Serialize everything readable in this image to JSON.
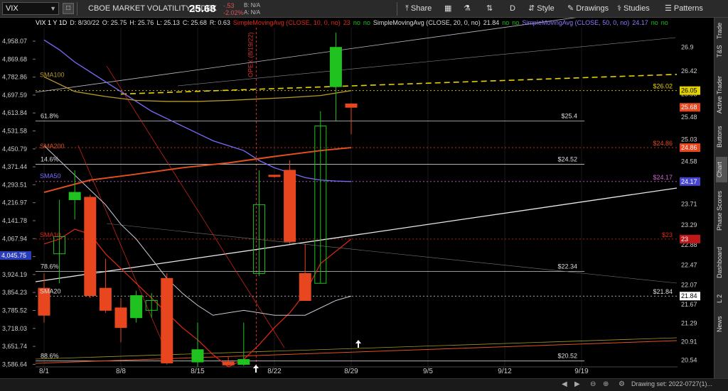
{
  "toolbar": {
    "symbol": "VIX",
    "description": "CBOE MARKET VOLATILITY INDEX",
    "last": "25.68",
    "change": "-.53",
    "change_pct": "-2.02%",
    "bid": "B: N/A",
    "ask": "A: N/A",
    "share_label": "Share",
    "aggregation": "D",
    "style_label": "Style",
    "drawings_label": "Drawings",
    "studies_label": "Studies",
    "patterns_label": "Patterns"
  },
  "right_tabs": [
    "Trade",
    "T&S",
    "Active Trader",
    "Buttons",
    "Chart",
    "Phase Scores",
    "Dashboard",
    "L 2",
    "News"
  ],
  "infobar": {
    "head": "VIX 1 Y 1D",
    "date": "D: 8/30/22",
    "open": "O: 25.75",
    "high": "H: 25.76",
    "low": "L: 25.13",
    "close": "C: 25.68",
    "range": "R: 0.63",
    "sma10": "SimpleMovingAvg (CLOSE, 10, 0, no)",
    "sma10_val": "23",
    "sma10_flag1": "no",
    "sma10_flag2": "no",
    "sma20": "SimpleMovingAvg (CLOSE, 20, 0, no)",
    "sma20_val": "21.84",
    "sma20_flag1": "no",
    "sma20_flag2": "no",
    "sma50": "SimpleMovingAvg (CLOSE, 50, 0, no)",
    "sma50_val": "24.17",
    "sma50_flag1": "no",
    "sma50_flag2": "no"
  },
  "bottombar": {
    "drawing_set": "Drawing set: 2022-0727(1)..."
  },
  "colors": {
    "up": "#1fc21f",
    "down": "#e8461e",
    "sma10": "#e02818",
    "sma20": "#c8c8d8",
    "sma50": "#7a6cff",
    "sma100": "#b89a28",
    "sma200": "#e05020",
    "trend": "#e8e8e8",
    "fib": "#cccccc",
    "yellow": "#e6d200",
    "opex": "#d83030"
  },
  "chart_data": {
    "type": "candlestick",
    "x_labels": [
      {
        "label": "8/1",
        "i": 0
      },
      {
        "label": "8/8",
        "i": 5
      },
      {
        "label": "8/15",
        "i": 10
      },
      {
        "label": "8/22",
        "i": 15
      },
      {
        "label": "8/29",
        "i": 20
      },
      {
        "label": "9/5",
        "i": 25
      },
      {
        "label": "9/12",
        "i": 30
      },
      {
        "label": "9/19",
        "i": 35
      }
    ],
    "left_axis_ticks": [
      "4,958.07",
      "4,869.68",
      "4,782.86",
      "4,697.59",
      "4,613.84",
      "4,531.58",
      "4,450.79",
      "4,371.44",
      "4,293.51",
      "4,216.97",
      "4,141.78",
      "4,067.94",
      "3,995.42",
      "3,924.19",
      "3,854.23",
      "3,785.52",
      "3,718.03",
      "3,651.74",
      "3,586.64"
    ],
    "left_axis_highlight": "4,045.75",
    "right_axis_ticks": [
      "26.9",
      "26.42",
      "25.95",
      "25.48",
      "25.03",
      "24.58",
      "24.13",
      "23.71",
      "23.29",
      "22.88",
      "22.47",
      "22.07",
      "21.67",
      "21.29",
      "20.91",
      "20.54"
    ],
    "y_range": [
      20.4,
      27.3
    ],
    "candles": [
      {
        "i": 0,
        "o": 22.0,
        "h": 22.3,
        "l": 21.3,
        "c": 21.45
      },
      {
        "i": 1,
        "o": 22.7,
        "h": 23.8,
        "l": 22.1,
        "c": 23.05
      },
      {
        "i": 2,
        "o": 23.8,
        "h": 24.4,
        "l": 23.4,
        "c": 23.95
      },
      {
        "i": 3,
        "o": 23.85,
        "h": 23.9,
        "l": 21.8,
        "c": 21.85
      },
      {
        "i": 4,
        "o": 22.0,
        "h": 22.6,
        "l": 21.5,
        "c": 21.55
      },
      {
        "i": 5,
        "o": 21.6,
        "h": 21.8,
        "l": 20.9,
        "c": 21.2
      },
      {
        "i": 6,
        "o": 21.4,
        "h": 21.95,
        "l": 21.3,
        "c": 21.85
      },
      {
        "i": 7,
        "o": 21.55,
        "h": 21.9,
        "l": 21.4,
        "c": 21.75
      },
      {
        "i": 8,
        "o": 22.2,
        "h": 22.3,
        "l": 20.45,
        "c": 20.48
      },
      {
        "i": 10,
        "o": 20.5,
        "h": 21.3,
        "l": 20.4,
        "c": 20.75
      },
      {
        "i": 12,
        "o": 20.5,
        "h": 20.6,
        "l": 20.42,
        "c": 20.44
      },
      {
        "i": 13,
        "o": 20.45,
        "h": 21.3,
        "l": 20.42,
        "c": 20.55
      },
      {
        "i": 14,
        "o": 22.3,
        "h": 24.4,
        "l": 22.25,
        "c": 23.7
      },
      {
        "i": 15,
        "o": 24.3,
        "h": 24.3,
        "l": 24.25,
        "c": 24.28
      },
      {
        "i": 16,
        "o": 24.4,
        "h": 24.6,
        "l": 22.9,
        "c": 22.95
      },
      {
        "i": 17,
        "o": 22.3,
        "h": 22.9,
        "l": 21.9,
        "c": 21.75
      },
      {
        "i": 18,
        "o": 22.1,
        "h": 25.6,
        "l": 22.1,
        "c": 25.3
      },
      {
        "i": 19,
        "o": 26.1,
        "h": 27.2,
        "l": 25.4,
        "c": 26.9
      },
      {
        "i": 20,
        "o": 25.75,
        "h": 25.76,
        "l": 25.13,
        "c": 25.68
      }
    ],
    "sma_studies": [
      {
        "name": "SMA10",
        "label": "SMA10",
        "value": "23",
        "line": [
          [
            0,
            22.9
          ],
          [
            1,
            23.0
          ],
          [
            2,
            23.2
          ],
          [
            3,
            23.1
          ],
          [
            4,
            22.7
          ],
          [
            5,
            22.4
          ],
          [
            6,
            22.1
          ],
          [
            7,
            21.8
          ],
          [
            8,
            21.5
          ],
          [
            9,
            21.2
          ],
          [
            10,
            20.95
          ],
          [
            11,
            20.65
          ],
          [
            12,
            20.4
          ],
          [
            13,
            20.55
          ],
          [
            14,
            20.85
          ],
          [
            15,
            21.2
          ],
          [
            16,
            21.5
          ],
          [
            17,
            21.9
          ],
          [
            18,
            22.5
          ],
          [
            19,
            22.75
          ],
          [
            20,
            23.0
          ]
        ]
      },
      {
        "name": "SMA20",
        "label": "SMA20",
        "value": "21.84",
        "line": [
          [
            0,
            24.9
          ],
          [
            1,
            24.6
          ],
          [
            2,
            24.3
          ],
          [
            3,
            24.0
          ],
          [
            4,
            23.7
          ],
          [
            5,
            23.3
          ],
          [
            6,
            23.0
          ],
          [
            7,
            22.6
          ],
          [
            8,
            22.2
          ],
          [
            9,
            21.9
          ],
          [
            10,
            21.65
          ],
          [
            11,
            21.45
          ],
          [
            12,
            21.5
          ],
          [
            13,
            21.55
          ],
          [
            14,
            21.5
          ],
          [
            15,
            21.45
          ],
          [
            16,
            21.45
          ],
          [
            17,
            21.45
          ],
          [
            18,
            21.6
          ],
          [
            19,
            21.75
          ],
          [
            20,
            21.84
          ]
        ]
      },
      {
        "name": "SMA50",
        "label": "SMA50",
        "value": "24.17",
        "line": [
          [
            0,
            27.05
          ],
          [
            1,
            26.85
          ],
          [
            2,
            26.6
          ],
          [
            3,
            26.4
          ],
          [
            4,
            26.2
          ],
          [
            5,
            26.0
          ],
          [
            6,
            25.8
          ],
          [
            7,
            25.6
          ],
          [
            8,
            25.45
          ],
          [
            9,
            25.3
          ],
          [
            10,
            25.15
          ],
          [
            11,
            25.0
          ],
          [
            12,
            24.9
          ],
          [
            13,
            24.8
          ],
          [
            14,
            24.6
          ],
          [
            15,
            24.45
          ],
          [
            16,
            24.35
          ],
          [
            17,
            24.25
          ],
          [
            18,
            24.2
          ],
          [
            19,
            24.18
          ],
          [
            20,
            24.17
          ]
        ]
      },
      {
        "name": "SMA100",
        "label": "SMA100",
        "value": "26.02",
        "line": [
          [
            0,
            26.3
          ],
          [
            2,
            26.0
          ],
          [
            4,
            25.9
          ],
          [
            6,
            25.82
          ],
          [
            8,
            25.8
          ],
          [
            10,
            25.8
          ],
          [
            12,
            25.82
          ],
          [
            14,
            25.85
          ],
          [
            16,
            25.88
          ],
          [
            18,
            25.92
          ],
          [
            20,
            26.02
          ]
        ]
      },
      {
        "name": "SMA200",
        "label": "SMA200",
        "value": "24.86",
        "line": [
          [
            0,
            23.95
          ],
          [
            3,
            24.2
          ],
          [
            6,
            24.32
          ],
          [
            9,
            24.45
          ],
          [
            12,
            24.55
          ],
          [
            15,
            24.68
          ],
          [
            18,
            24.8
          ],
          [
            20,
            24.86
          ]
        ]
      }
    ],
    "fib_levels": [
      {
        "label": "61.8%",
        "value": 25.4,
        "text": "$25.4"
      },
      {
        "label": "14.6%",
        "value": 24.52,
        "text": "$24.52"
      },
      {
        "label": "78.6%",
        "value": 22.34,
        "text": "$22.34"
      },
      {
        "label": "88.6%",
        "value": 20.52,
        "text": "$20.52"
      }
    ],
    "price_tags": [
      {
        "value": 26.02,
        "text": "26.05",
        "color": "#e6d200",
        "text_color": "#000"
      },
      {
        "value": 25.68,
        "text": "25.68",
        "color": "#e8461e",
        "text_color": "#fff"
      },
      {
        "value": 24.86,
        "text": "24.86",
        "color": "#e8461e",
        "text_color": "#fff"
      },
      {
        "value": 24.17,
        "text": "24.17",
        "color": "#4646d0",
        "text_color": "#fff"
      },
      {
        "value": 23.0,
        "text": "23",
        "color": "#c01818",
        "text_color": "#fff"
      },
      {
        "value": 21.84,
        "text": "21.84",
        "color": "#ffffff",
        "text_color": "#000"
      }
    ],
    "level_labels": [
      {
        "value": 26.02,
        "text": "$26.02",
        "color": "#e6d200"
      },
      {
        "value": 24.86,
        "text": "$24.86",
        "color": "#e8461e"
      },
      {
        "value": 24.17,
        "text": "$24.17",
        "color": "#d060d0"
      },
      {
        "value": 23.0,
        "text": "$23",
        "color": "#e02818"
      },
      {
        "value": 21.84,
        "text": "$21.84",
        "color": "#dddddd"
      }
    ],
    "vertical_annotation": {
      "text": "OPEX (8/19/22)",
      "i": 14
    }
  }
}
